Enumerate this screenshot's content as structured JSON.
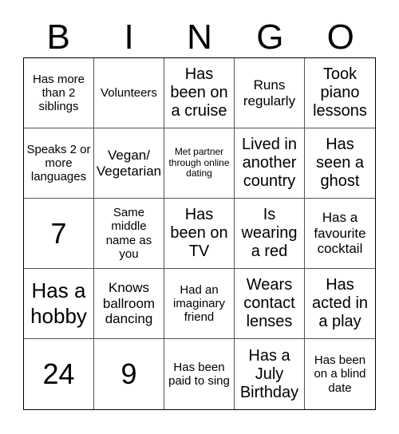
{
  "header": {
    "letters": [
      "B",
      "I",
      "N",
      "G",
      "O"
    ]
  },
  "cells": [
    {
      "text": "Has more than 2 siblings",
      "size": "s-sm"
    },
    {
      "text": "Volunteers",
      "size": "s-sm"
    },
    {
      "text": "Has been on a cruise",
      "size": "s-lg"
    },
    {
      "text": "Runs regularly",
      "size": "s-md"
    },
    {
      "text": "Took piano lessons",
      "size": "s-lg"
    },
    {
      "text": "Speaks 2 or more languages",
      "size": "s-sm"
    },
    {
      "text": "Vegan/ Vegetarian",
      "size": "s-md"
    },
    {
      "text": "Met partner through online dating",
      "size": "s-xs"
    },
    {
      "text": "Lived in another country",
      "size": "s-lg"
    },
    {
      "text": "Has seen a ghost",
      "size": "s-lg"
    },
    {
      "text": "7",
      "size": "s-num"
    },
    {
      "text": "Same middle name as you",
      "size": "s-sm"
    },
    {
      "text": "Has been on TV",
      "size": "s-lg"
    },
    {
      "text": "Is wearing a red",
      "size": "s-lg"
    },
    {
      "text": "Has a favourite cocktail",
      "size": "s-md"
    },
    {
      "text": "Has a hobby",
      "size": "s-xl"
    },
    {
      "text": "Knows ballroom dancing",
      "size": "s-md"
    },
    {
      "text": "Had an imaginary friend",
      "size": "s-sm"
    },
    {
      "text": "Wears contact lenses",
      "size": "s-lg"
    },
    {
      "text": "Has acted in a play",
      "size": "s-lg"
    },
    {
      "text": "24",
      "size": "s-num"
    },
    {
      "text": "9",
      "size": "s-num"
    },
    {
      "text": "Has been paid to sing",
      "size": "s-sm"
    },
    {
      "text": "Has a July Birthday",
      "size": "s-lg"
    },
    {
      "text": "Has been on a blind date",
      "size": "s-sm"
    }
  ]
}
